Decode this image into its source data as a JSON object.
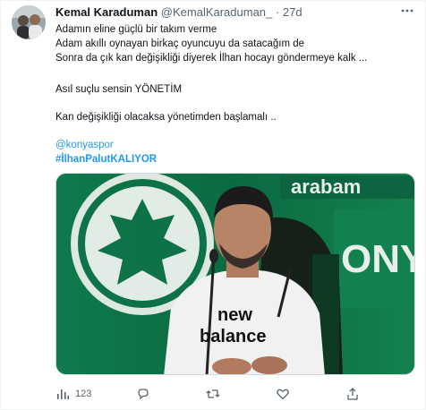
{
  "tweet": {
    "display_name": "Kemal Karaduman",
    "handle": "@KemalKaraduman_",
    "separator": "·",
    "time": "27d",
    "lines": [
      "Adamın eline güçlü bir takım verme",
      "Adam akıllı oynayan birkaç oyuncuyu da satacağım de",
      "Sonra da çık kan değişikliği diyerek İlhan hocayı göndermeye kalk ...",
      "Asıl suçlu sensin YÖNETİM",
      "Kan değişikliği olacaksa yönetimden başlamalı .."
    ],
    "mention": "@konyaspor",
    "hashtag": "#İlhanPalutKALIYOR",
    "media": {
      "background_text": "arabam",
      "shirt_line_1": "new",
      "shirt_line_2": "balance"
    }
  },
  "actions": {
    "views_count": "123",
    "reply_count": "",
    "retweet_count": "",
    "like_count": ""
  },
  "icons": {
    "more": "more-icon",
    "views": "views-icon",
    "reply": "reply-icon",
    "retweet": "retweet-icon",
    "like": "like-icon",
    "share": "share-icon"
  },
  "colors": {
    "link": "#1d9bf0",
    "secondary_text": "#536471",
    "pitch_green": "#0d6b43"
  }
}
